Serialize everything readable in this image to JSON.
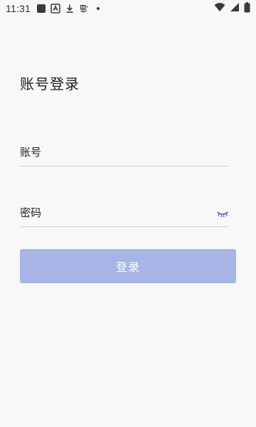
{
  "status_bar": {
    "time": "11:31",
    "icons": [
      "app-square-icon",
      "translate-icon",
      "download-icon",
      "custom-app-icon",
      "dot-icon"
    ],
    "right_icons": [
      "wifi-icon",
      "cellular-signal-icon",
      "battery-icon"
    ]
  },
  "page": {
    "title": "账号登录"
  },
  "form": {
    "account_label": "账号",
    "password_label": "密码",
    "login_label": "登录"
  },
  "colors": {
    "background": "#f8f8f9",
    "button_bg": "#a6b4e6",
    "divider": "#cfd1d9",
    "eye_icon": "#3d5bb5"
  }
}
